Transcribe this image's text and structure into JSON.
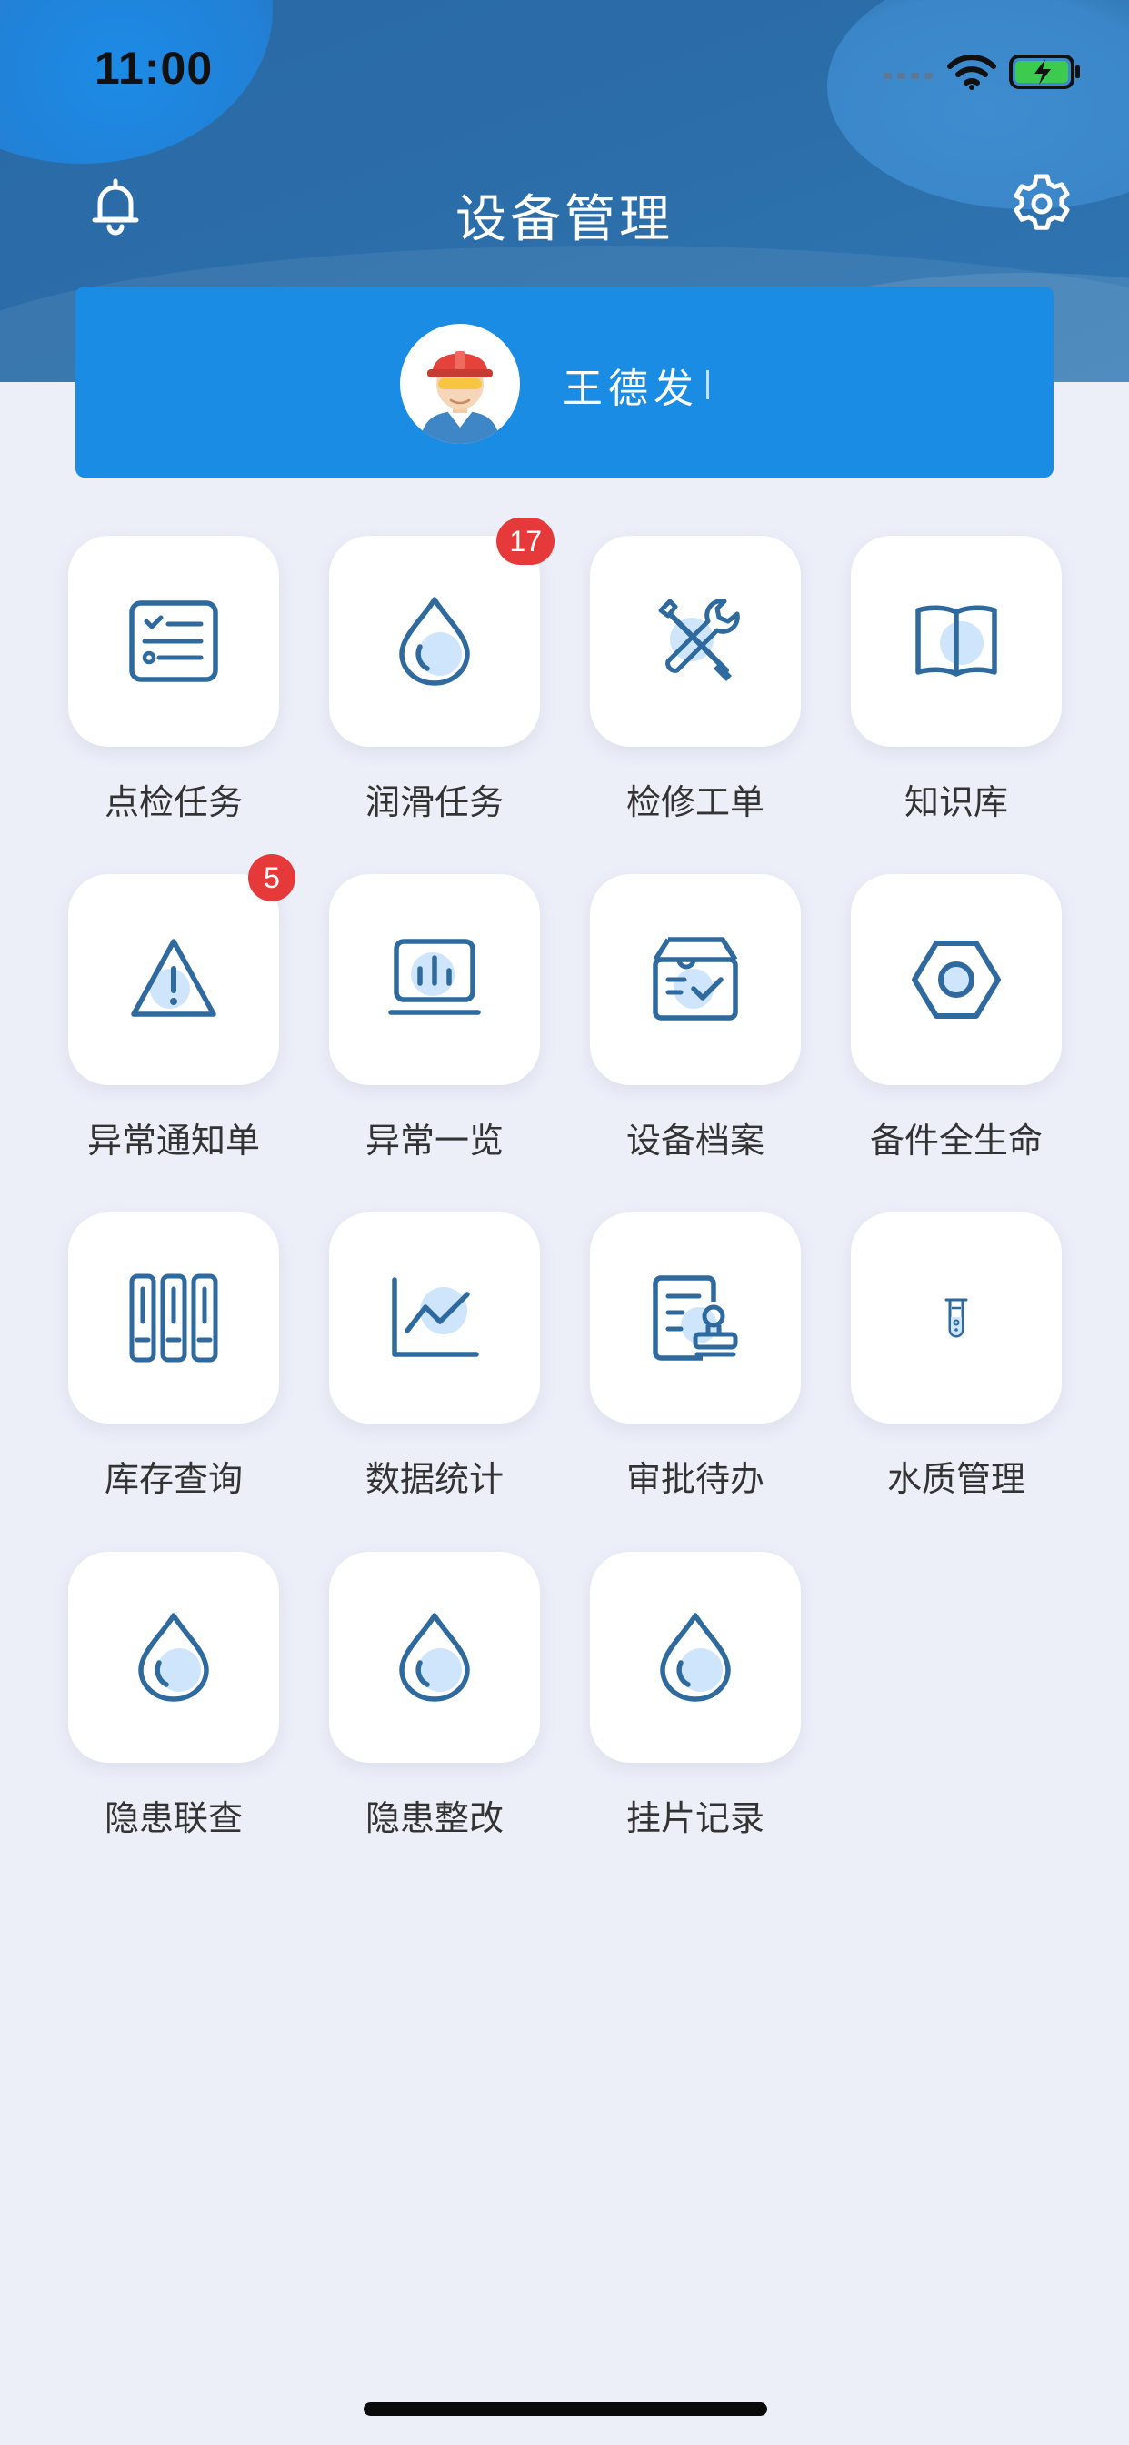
{
  "status_bar": {
    "time": "11:00"
  },
  "header": {
    "title": "设备管理",
    "bell_icon": "bell-icon",
    "settings_icon": "gear-icon"
  },
  "user": {
    "name": "王德发",
    "avatar_icon": "worker-avatar-icon"
  },
  "colors": {
    "accent": "#1b8ce3",
    "header": "#2b6da8",
    "icon_stroke": "#2f6a9e",
    "icon_fill": "#cfe5fb",
    "badge": "#e63a3a",
    "background": "#eceff8"
  },
  "menu": [
    {
      "label": "点检任务",
      "icon": "checklist-icon"
    },
    {
      "label": "润滑任务",
      "icon": "oil-drop-icon",
      "badge": "17"
    },
    {
      "label": "检修工单",
      "icon": "wrench-screwdriver-icon"
    },
    {
      "label": "知识库",
      "icon": "book-icon"
    },
    {
      "label": "异常通知单",
      "icon": "warning-icon",
      "badge": "5"
    },
    {
      "label": "异常一览",
      "icon": "monitor-chart-icon"
    },
    {
      "label": "设备档案",
      "icon": "archive-box-icon"
    },
    {
      "label": "备件全生命",
      "icon": "hex-nut-icon"
    },
    {
      "label": "库存查询",
      "icon": "binders-icon"
    },
    {
      "label": "数据统计",
      "icon": "line-chart-icon"
    },
    {
      "label": "审批待办",
      "icon": "approval-stamp-icon"
    },
    {
      "label": "水质管理",
      "icon": "test-tube-icon"
    },
    {
      "label": "隐患联查",
      "icon": "drop-icon"
    },
    {
      "label": "隐患整改",
      "icon": "drop-icon"
    },
    {
      "label": "挂片记录",
      "icon": "drop-icon"
    }
  ]
}
